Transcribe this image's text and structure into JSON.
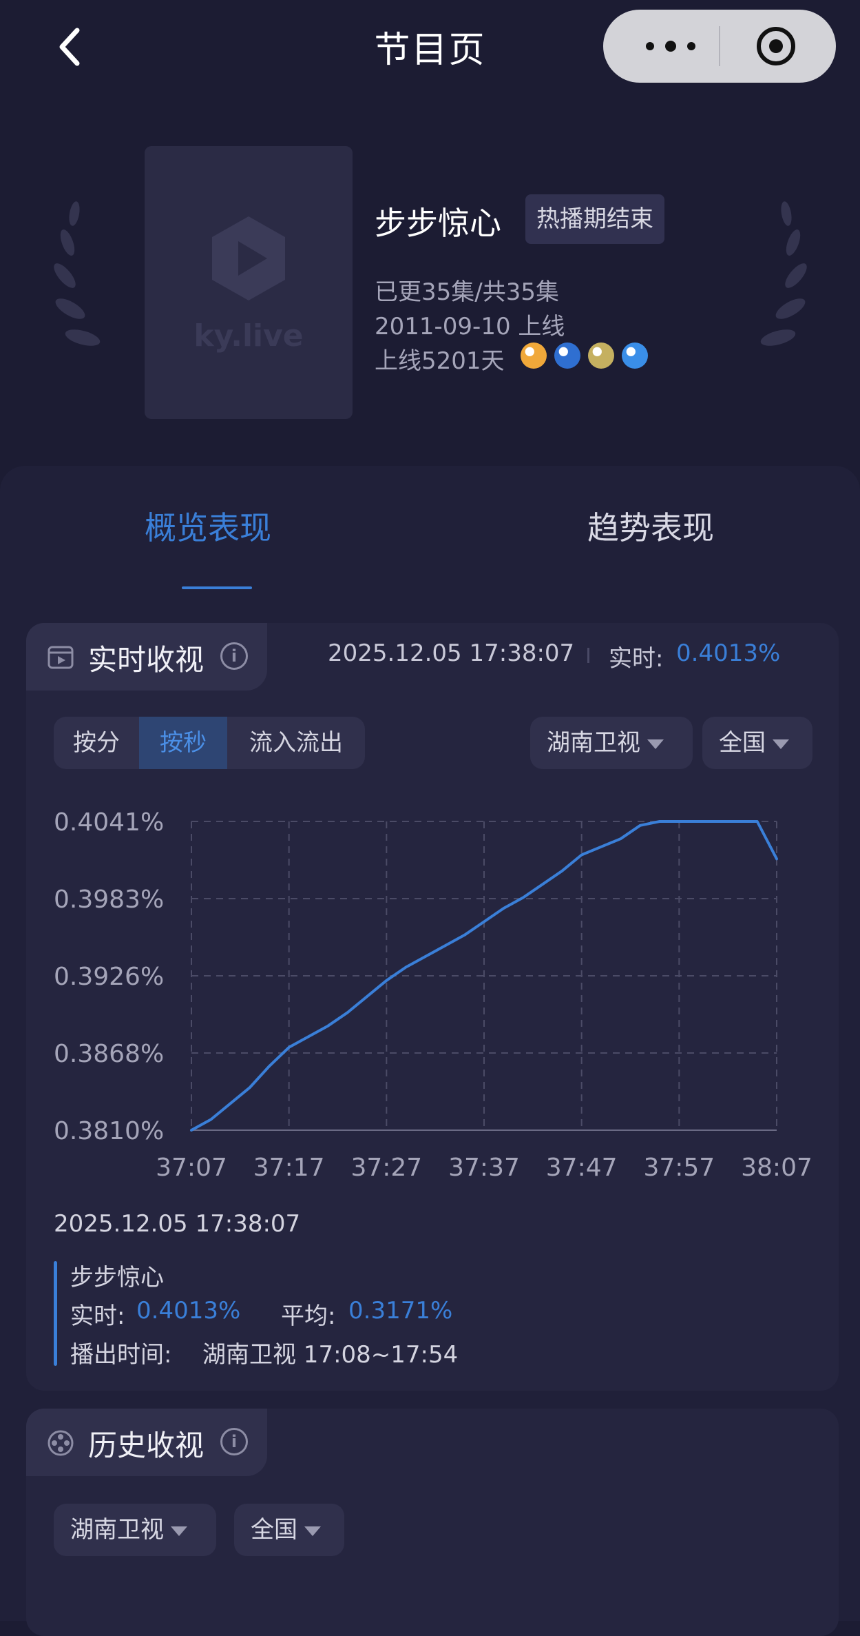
{
  "topbar": {
    "title": "节目页",
    "back_icon": "chevron-left-icon",
    "more_icon": "more-dots-icon",
    "target_icon": "target-icon"
  },
  "show": {
    "poster_text": "ky.live",
    "title": "步步惊心",
    "status": "热播期结束",
    "episodes": "已更35集/共35集",
    "premiere": "2011-09-10 上线",
    "days_online": "上线5201天",
    "channel_icons": [
      "#f0a83a",
      "#2f6fd1",
      "#c5b060",
      "#3a8ee8"
    ]
  },
  "tabs": [
    {
      "label": "概览表现",
      "active": true
    },
    {
      "label": "趋势表现",
      "active": false
    }
  ],
  "realtime": {
    "title": "实时收视",
    "timestamp": "2025.12.05 17:38:07",
    "realtime_label": "实时:",
    "realtime_value": "0.4013%",
    "segments": [
      {
        "label": "按分",
        "active": false
      },
      {
        "label": "按秒",
        "active": true
      },
      {
        "label": "流入流出",
        "active": false
      }
    ],
    "channel_select": "湖南卫视",
    "region_select": "全国"
  },
  "chart_data": {
    "type": "line",
    "x_ticks": [
      "37:07",
      "37:17",
      "37:27",
      "37:37",
      "37:47",
      "37:57",
      "38:07"
    ],
    "y_ticks": [
      "0.4041%",
      "0.3983%",
      "0.3926%",
      "0.3868%",
      "0.3810%"
    ],
    "ylim": [
      0.381,
      0.4041
    ],
    "grid": true,
    "series": [
      {
        "x": [
          0,
          2,
          4,
          6,
          8,
          10,
          12,
          14,
          16,
          18,
          20,
          22,
          24,
          26,
          28,
          30,
          32,
          34,
          36,
          38,
          40,
          42,
          44,
          46,
          48,
          50,
          52,
          54,
          56,
          58,
          60
        ],
        "y": [
          0.381,
          0.3818,
          0.383,
          0.3842,
          0.3858,
          0.3872,
          0.388,
          0.3888,
          0.3898,
          0.391,
          0.3922,
          0.3932,
          0.394,
          0.3948,
          0.3956,
          0.3966,
          0.3976,
          0.3984,
          0.3994,
          0.4004,
          0.4016,
          0.4022,
          0.4028,
          0.4038,
          0.4046,
          0.4056,
          0.4066,
          0.4074,
          0.408,
          0.4041,
          0.4013
        ]
      }
    ]
  },
  "tooltip": {
    "time": "2025.12.05 17:38:07",
    "name": "步步惊心",
    "realtime_label": "实时:",
    "realtime_value": "0.4013%",
    "avg_label": "平均:",
    "avg_value": "0.3171%",
    "airtime_label": "播出时间:",
    "airtime_value": "湖南卫视 17:08~17:54"
  },
  "history": {
    "title": "历史收视",
    "channel_select": "湖南卫视",
    "region_select": "全国"
  },
  "colors": {
    "accent": "#3a7fd8",
    "background": "#1c1c33",
    "panel": "#202039"
  }
}
